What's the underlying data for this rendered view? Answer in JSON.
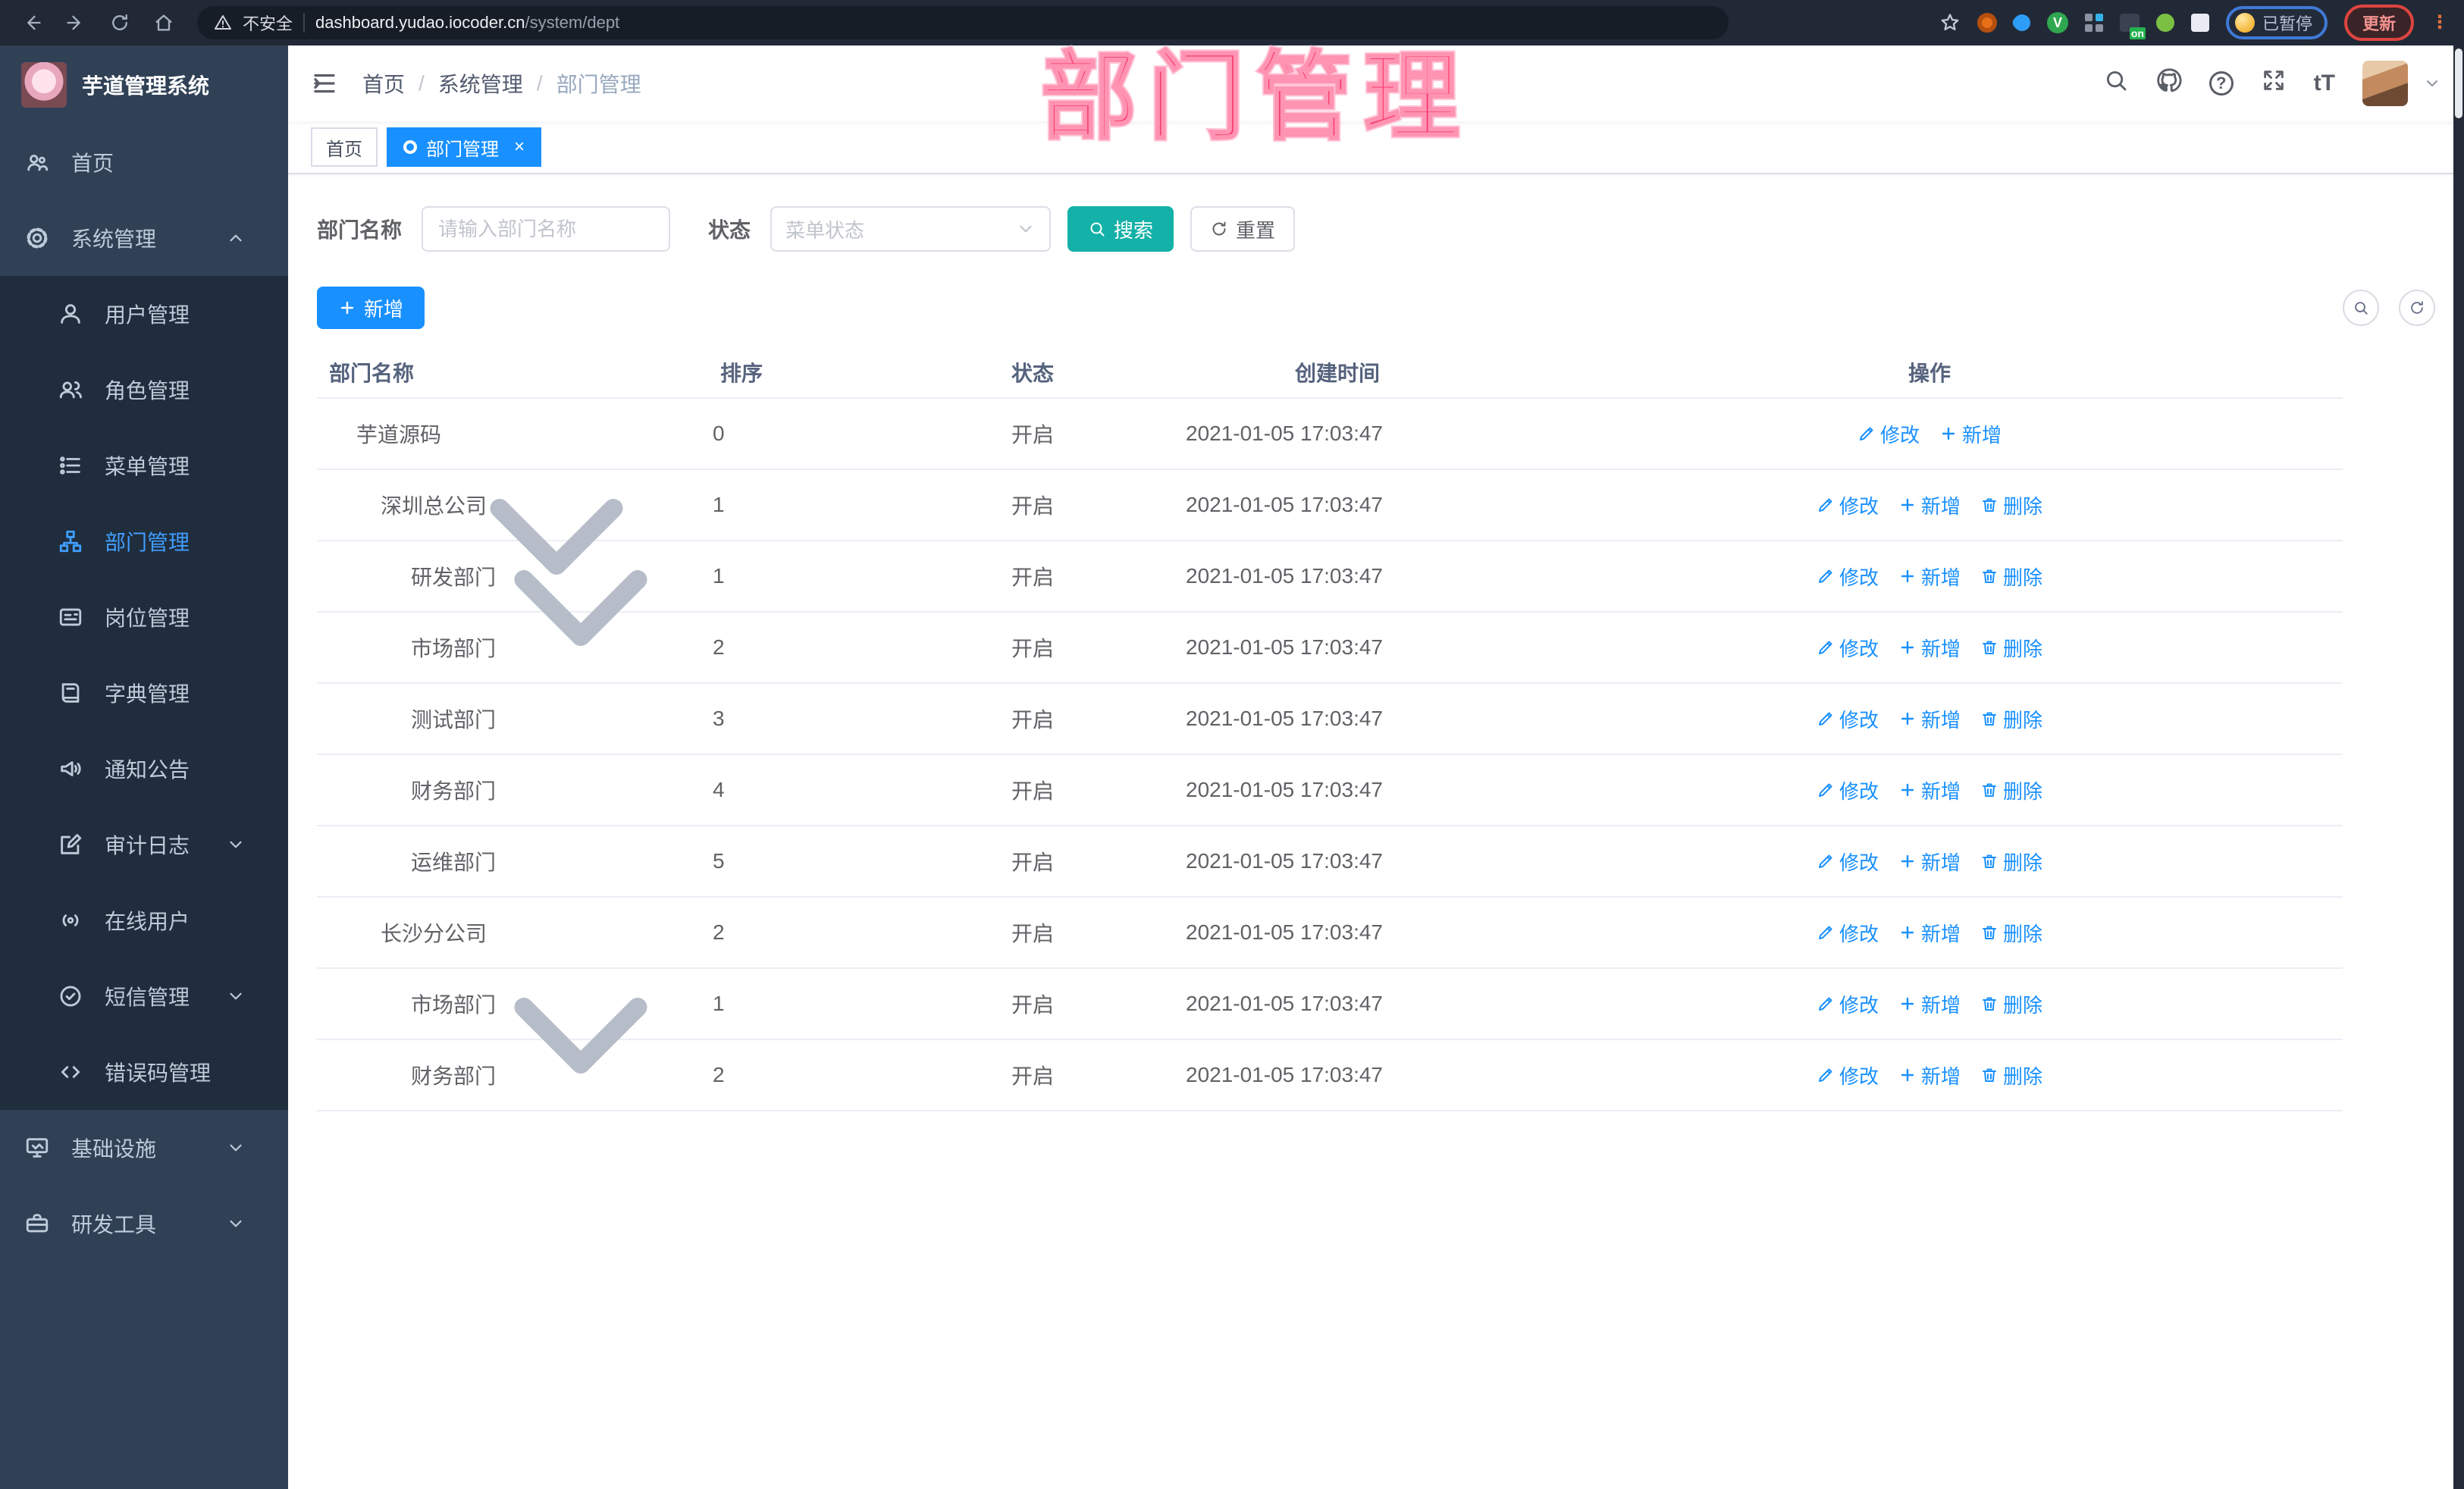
{
  "browser": {
    "security_label": "不安全",
    "url_host": "dashboard.yudao.iocoder.cn",
    "url_path": "/system/dept",
    "paused_label": "已暂停",
    "update_label": "更新",
    "menu_dots": "⋮"
  },
  "overlay": {
    "title": "部门管理",
    "color": "#f93a6e"
  },
  "sidebar": {
    "app_title": "芋道管理系统",
    "items": [
      {
        "label": "首页",
        "icon": "home-icon"
      },
      {
        "label": "系统管理",
        "icon": "gear-icon",
        "expanded": true
      },
      {
        "label": "用户管理",
        "icon": "user-icon"
      },
      {
        "label": "角色管理",
        "icon": "role-icon"
      },
      {
        "label": "菜单管理",
        "icon": "menu-list-icon"
      },
      {
        "label": "部门管理",
        "icon": "dept-tree-icon",
        "active": true
      },
      {
        "label": "岗位管理",
        "icon": "post-card-icon"
      },
      {
        "label": "字典管理",
        "icon": "dict-book-icon"
      },
      {
        "label": "通知公告",
        "icon": "notice-horn-icon"
      },
      {
        "label": "审计日志",
        "icon": "audit-log-icon",
        "collapsed": true
      },
      {
        "label": "在线用户",
        "icon": "online-user-icon"
      },
      {
        "label": "短信管理",
        "icon": "sms-icon",
        "collapsed": true
      },
      {
        "label": "错误码管理",
        "icon": "error-code-icon"
      },
      {
        "label": "基础设施",
        "icon": "infrastructure-icon",
        "collapsed": true
      },
      {
        "label": "研发工具",
        "icon": "devtools-icon",
        "collapsed": true
      }
    ]
  },
  "header": {
    "breadcrumb": [
      "首页",
      "系统管理",
      "部门管理"
    ]
  },
  "tabs": [
    {
      "label": "首页",
      "active": false
    },
    {
      "label": "部门管理",
      "active": true
    }
  ],
  "filters": {
    "dept_label": "部门名称",
    "dept_placeholder": "请输入部门名称",
    "status_label": "状态",
    "status_placeholder": "菜单状态",
    "search_label": "搜索",
    "reset_label": "重置"
  },
  "toolbar": {
    "add_label": "新增"
  },
  "table": {
    "columns": [
      "部门名称",
      "排序",
      "状态",
      "创建时间",
      "操作"
    ],
    "ops": {
      "edit": "修改",
      "add": "新增",
      "delete": "删除"
    },
    "rows": [
      {
        "name": "芋道源码",
        "level": 0,
        "sort": "0",
        "status": "开启",
        "created": "2021-01-05 17:03:47"
      },
      {
        "name": "深圳总公司",
        "level": 1,
        "sort": "1",
        "status": "开启",
        "created": "2021-01-05 17:03:47"
      },
      {
        "name": "研发部门",
        "level": 2,
        "sort": "1",
        "status": "开启",
        "created": "2021-01-05 17:03:47"
      },
      {
        "name": "市场部门",
        "level": 2,
        "sort": "2",
        "status": "开启",
        "created": "2021-01-05 17:03:47"
      },
      {
        "name": "测试部门",
        "level": 2,
        "sort": "3",
        "status": "开启",
        "created": "2021-01-05 17:03:47"
      },
      {
        "name": "财务部门",
        "level": 2,
        "sort": "4",
        "status": "开启",
        "created": "2021-01-05 17:03:47"
      },
      {
        "name": "运维部门",
        "level": 2,
        "sort": "5",
        "status": "开启",
        "created": "2021-01-05 17:03:47"
      },
      {
        "name": "长沙分公司",
        "level": 1,
        "sort": "2",
        "status": "开启",
        "created": "2021-01-05 17:03:47"
      },
      {
        "name": "市场部门",
        "level": 2,
        "sort": "1",
        "status": "开启",
        "created": "2021-01-05 17:03:47"
      },
      {
        "name": "财务部门",
        "level": 2,
        "sort": "2",
        "status": "开启",
        "created": "2021-01-05 17:03:47"
      }
    ]
  },
  "colors": {
    "primary": "#1890ff",
    "teal": "#13b1a8",
    "sidebar_bg": "#304156",
    "submenu_bg": "#1f2d3d",
    "active_text": "#409eff"
  }
}
